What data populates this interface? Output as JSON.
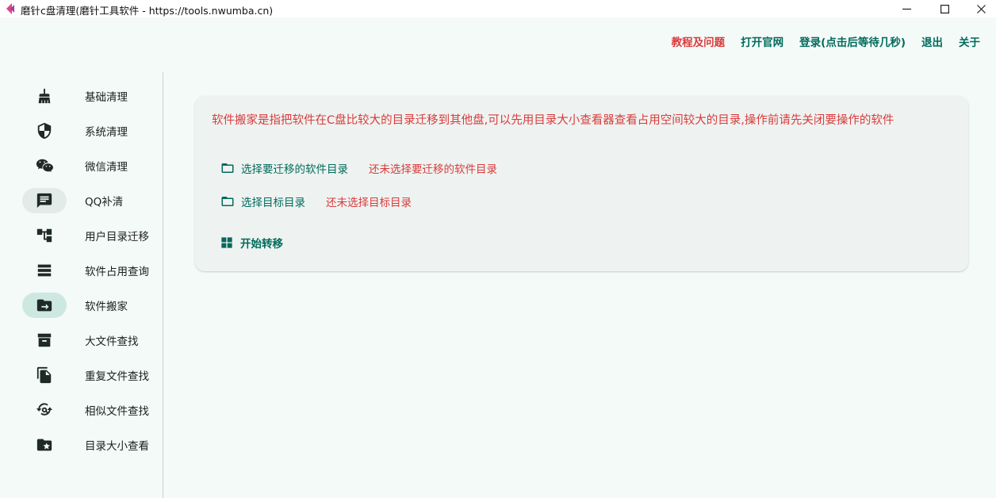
{
  "window": {
    "title": "磨针c盘清理(磨针工具软件 - https://tools.nwumba.cn)",
    "minimize": "—",
    "maximize": "☐",
    "close": "✕"
  },
  "topnav": {
    "help": "教程及问题",
    "website": "打开官网",
    "login": "登录(点击后等待几秒)",
    "logout": "退出",
    "about": "关于"
  },
  "sidebar": {
    "items": [
      {
        "label": "基础清理",
        "icon": "broom-icon"
      },
      {
        "label": "系统清理",
        "icon": "shield-icon"
      },
      {
        "label": "微信清理",
        "icon": "wechat-icon"
      },
      {
        "label": "QQ补清",
        "icon": "chat-icon"
      },
      {
        "label": "用户目录迁移",
        "icon": "tree-icon"
      },
      {
        "label": "软件占用查询",
        "icon": "list-icon"
      },
      {
        "label": "软件搬家",
        "icon": "folder-arrow-icon"
      },
      {
        "label": "大文件查找",
        "icon": "archive-icon"
      },
      {
        "label": "重复文件查找",
        "icon": "copy-icon"
      },
      {
        "label": "相似文件查找",
        "icon": "refresh-search-icon"
      },
      {
        "label": "目录大小查看",
        "icon": "folder-star-icon"
      }
    ],
    "selected_index": 6
  },
  "main": {
    "description": "软件搬家是指把软件在C盘比较大的目录迁移到其他盘,可以先用目录大小查看器查看占用空间较大的目录,操作前请先关闭要操作的软件",
    "select_source_label": "选择要迁移的软件目录",
    "select_source_status": "还未选择要迁移的软件目录",
    "select_target_label": "选择目标目录",
    "select_target_status": "还未选择目标目录",
    "start_label": "开始转移"
  },
  "colors": {
    "accent": "#006a5c",
    "warning": "#d93b3b",
    "selected_bg": "#cde8e1"
  }
}
